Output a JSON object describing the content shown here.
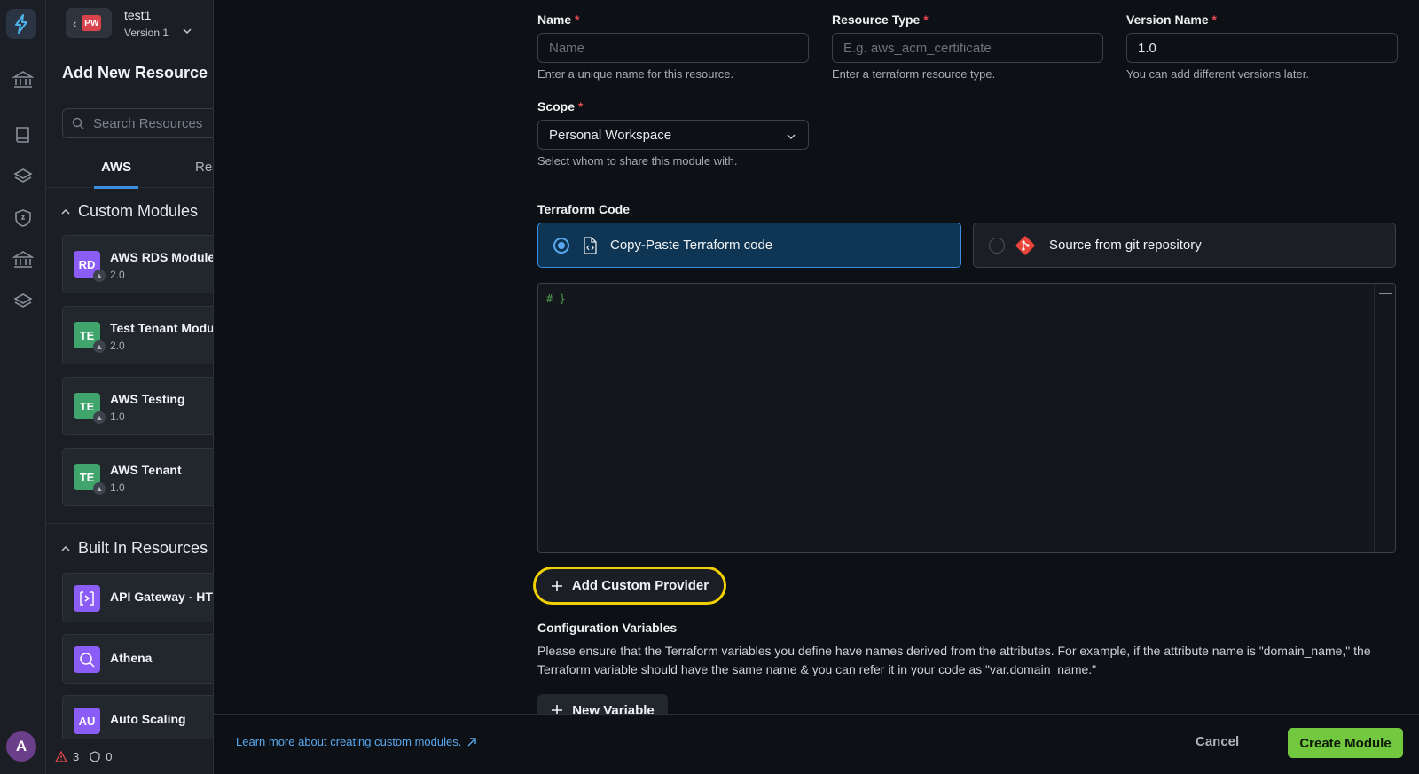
{
  "workspace": {
    "badge": "PW",
    "name": "test1",
    "version": "Version 1"
  },
  "sidebar": {
    "title": "Add New Resource",
    "search_placeholder": "Search Resources",
    "tabs": [
      "AWS",
      "Res"
    ],
    "custom_modules": {
      "title": "Custom Modules",
      "items": [
        {
          "badge": "RD",
          "name": "AWS RDS Module",
          "version": "2.0",
          "color": "#8b5cf6"
        },
        {
          "badge": "TE",
          "name": "Test Tenant Module",
          "version": "2.0",
          "color": "#3fa56c"
        },
        {
          "badge": "TE",
          "name": "AWS Testing",
          "version": "1.0",
          "color": "#3fa56c"
        },
        {
          "badge": "TE",
          "name": "AWS Tenant",
          "version": "1.0",
          "color": "#3fa56c"
        }
      ]
    },
    "built_in": {
      "title": "Built In Resources",
      "items": [
        {
          "name": "API Gateway - HTTP",
          "icon": "api-gateway-icon"
        },
        {
          "name": "Athena",
          "icon": "athena-icon"
        },
        {
          "badge": "AU",
          "name": "Auto Scaling"
        }
      ]
    },
    "status": {
      "warnings": "3",
      "security": "0"
    },
    "user_initial": "A"
  },
  "form": {
    "name": {
      "label": "Name",
      "placeholder": "Name",
      "hint": "Enter a unique name for this resource."
    },
    "resource_type": {
      "label": "Resource Type",
      "placeholder": "E.g. aws_acm_certificate",
      "hint": "Enter a terraform resource type."
    },
    "version_name": {
      "label": "Version Name",
      "value": "1.0",
      "hint": "You can add different versions later."
    },
    "scope": {
      "label": "Scope",
      "value": "Personal Workspace",
      "hint": "Select whom to share this module with."
    },
    "terraform": {
      "label": "Terraform Code",
      "option_paste": "Copy-Paste Terraform code",
      "option_git": "Source from git repository",
      "code": "# }"
    },
    "add_provider": "Add Custom Provider",
    "config": {
      "label": "Configuration Variables",
      "description": "Please ensure that the Terraform variables you define have names derived from the attributes. For example, if the attribute name is \"domain_name,\" the Terraform variable should have the same name & you can refer it in your code as \"var.domain_name.\""
    },
    "new_variable": "New Variable"
  },
  "footer": {
    "learn_more": "Learn more about creating custom modules.",
    "cancel": "Cancel",
    "create": "Create Module"
  },
  "colors": {
    "accent": "#3b8de0",
    "primary_button": "#72c93f",
    "highlight": "#f0d000",
    "required": "#e5484d"
  }
}
